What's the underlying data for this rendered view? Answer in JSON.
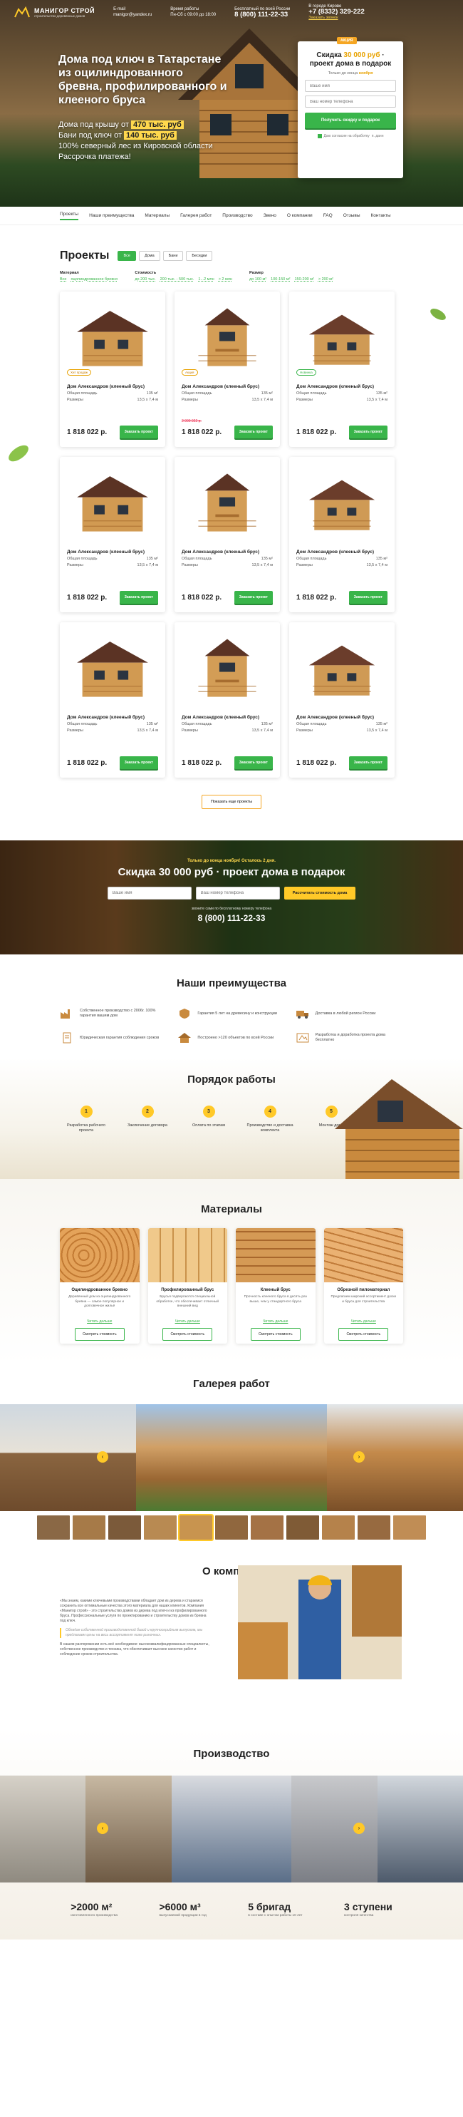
{
  "header": {
    "logo_name": "МАНИГОР СТРОЙ",
    "logo_sub": "строительство деревянных домов",
    "email_label": "E-mail",
    "email": "manigor@yandex.ru",
    "hours_label": "Время работы",
    "hours": "Пн-Сб с 09:00 до 18:00",
    "free_call_label": "Бесплатный по всей России",
    "free_phone": "8 (800) 111-22-33",
    "city_label": "В городе Кирове",
    "city_phone": "+7 (8332) 329-222",
    "callback_link": "Заказать звонок"
  },
  "hero": {
    "title": "Дома под ключ в Татарстане из оцилиндрованного бревна, профилированного и клееного бруса",
    "line1_prefix": "Дома под крышу от",
    "line1_price": "470 тыс. руб",
    "line2_prefix": "Бани под ключ от",
    "line2_price": "140 тыс. руб",
    "line3": "100% северный лес из Кировской области",
    "line4": "Рассрочка платежа!"
  },
  "hero_form": {
    "badge": "АКЦИЯ",
    "title_pre": "Скидка",
    "title_acc": "30 000 руб",
    "title_post": "· проект дома в подарок",
    "note_pre": "Только до конца",
    "note_acc": "ноября",
    "name_placeholder": "Ваше имя",
    "phone_placeholder": "Ваш номер телефона",
    "submit": "Получить скидку и подарок",
    "agree": "Даю согласие на обработку",
    "agree_suffix": "п. данн"
  },
  "nav": [
    "Проекты",
    "Наши преимущества",
    "Материалы",
    "Галерея работ",
    "Производство",
    "Звено",
    "О компании",
    "FAQ",
    "Отзывы",
    "Контакты"
  ],
  "projects": {
    "title": "Проекты",
    "tabs": [
      "Все",
      "Дома",
      "Бани",
      "Беседки"
    ],
    "filter_material_label": "Материал",
    "filter_materials": [
      "Все",
      "оцилиндрованное бревно"
    ],
    "filter_cost_label": "Стоимость",
    "filter_costs": [
      "до 200 тыс.",
      "200 тыс. - 500 тыс.",
      "1...2 млн",
      "> 2 млн"
    ],
    "filter_size_label": "Размер",
    "filter_sizes": [
      "до 100 м²",
      "100-150 м²",
      "150-200 м²",
      "> 200 м²"
    ],
    "cards": [
      {
        "name": "Дом Александров (клееный брус)",
        "area_label": "Общая площадь",
        "area": "135 м²",
        "size_label": "Размеры",
        "size": "13,5 х 7,4 м",
        "price": "1 818 022 р.",
        "button": "Заказать проект",
        "badge": "Хит продаж",
        "old_price": ""
      },
      {
        "name": "Дом Александров (клееный брус)",
        "area_label": "Общая площадь",
        "area": "135 м²",
        "size_label": "Размеры",
        "size": "13,5 х 7,4 м",
        "price": "1 818 022 р.",
        "button": "Заказать проект",
        "badge": "Акция",
        "old_price": "2 000 022 р."
      },
      {
        "name": "Дом Александров (клееный брус)",
        "area_label": "Общая площадь",
        "area": "135 м²",
        "size_label": "Размеры",
        "size": "13,5 х 7,4 м",
        "price": "1 818 022 р.",
        "button": "Заказать проект",
        "badge": "Новинка",
        "old_price": ""
      },
      {
        "name": "Дом Александров (клееный брус)",
        "area_label": "Общая площадь",
        "area": "135 м²",
        "size_label": "Размеры",
        "size": "13,5 х 7,4 м",
        "price": "1 818 022 р.",
        "button": "Заказать проект",
        "badge": "",
        "old_price": ""
      },
      {
        "name": "Дом Александров (клееный брус)",
        "area_label": "Общая площадь",
        "area": "135 м²",
        "size_label": "Размеры",
        "size": "13,5 х 7,4 м",
        "price": "1 818 022 р.",
        "button": "Заказать проект",
        "badge": "",
        "old_price": ""
      },
      {
        "name": "Дом Александров (клееный брус)",
        "area_label": "Общая площадь",
        "area": "135 м²",
        "size_label": "Размеры",
        "size": "13,5 х 7,4 м",
        "price": "1 818 022 р.",
        "button": "Заказать проект",
        "badge": "",
        "old_price": ""
      },
      {
        "name": "Дом Александров (клееный брус)",
        "area_label": "Общая площадь",
        "area": "135 м²",
        "size_label": "Размеры",
        "size": "13,5 х 7,4 м",
        "price": "1 818 022 р.",
        "button": "Заказать проект",
        "badge": "",
        "old_price": ""
      },
      {
        "name": "Дом Александров (клееный брус)",
        "area_label": "Общая площадь",
        "area": "135 м²",
        "size_label": "Размеры",
        "size": "13,5 х 7,4 м",
        "price": "1 818 022 р.",
        "button": "Заказать проект",
        "badge": "",
        "old_price": ""
      },
      {
        "name": "Дом Александров (клееный брус)",
        "area_label": "Общая площадь",
        "area": "135 м²",
        "size_label": "Размеры",
        "size": "13,5 х 7,4 м",
        "price": "1 818 022 р.",
        "button": "Заказать проект",
        "badge": "",
        "old_price": ""
      }
    ],
    "show_all": "Показать еще проекты"
  },
  "promo": {
    "kicker": "Только до конца ноября! Осталось 2 дня.",
    "title": "Скидка 30 000 руб · проект дома в подарок",
    "name_placeholder": "Ваше имя",
    "phone_placeholder": "Ваш номер телефона",
    "submit": "Рассчитать стоимость дома",
    "sub": "звоните сами по бесплатному номеру телефона",
    "phone": "8 (800) 111-22-33"
  },
  "advantages": {
    "title": "Наши преимущества",
    "items": [
      "Собственное производство с 2006г. 100% гарантия вашим дом",
      "Гарантия 5 лет на древесину и конструкции",
      "Доставка в любой регион России",
      "Юридическая гарантия соблюдения сроков",
      "Построено >120 объектов по всей России",
      "Разработка и доработка проекта дома бесплатно"
    ]
  },
  "steps": {
    "title": "Порядок работы",
    "items": [
      {
        "num": "1",
        "label": "Разработка рабочего проекта"
      },
      {
        "num": "2",
        "label": "Заключение договора"
      },
      {
        "num": "3",
        "label": "Оплата по этапам"
      },
      {
        "num": "4",
        "label": "Производство и доставка комплекта"
      },
      {
        "num": "5",
        "label": "Монтаж дома"
      }
    ]
  },
  "materials": {
    "title": "Материалы",
    "items": [
      {
        "name": "Оцилиндрованное бревно",
        "desc": "Деревянный дом из оцилиндрованного бревна — самое популярное и долговечное жильё",
        "more": "Читать дальше",
        "button": "Смотреть стоимость"
      },
      {
        "name": "Профилированный брус",
        "desc": "Брусья подвергаются специальной обработке, что обеспечивает отличный внешний вид",
        "more": "Читать дальше",
        "button": "Смотреть стоимость"
      },
      {
        "name": "Клееный брус",
        "desc": "Прочность клееного бруса в десять раз выше, чем у стандартного бруса",
        "more": "Читать дальше",
        "button": "Смотреть стоимость"
      },
      {
        "name": "Обрезной пиломатериал",
        "desc": "Предлагаем широкий ассортимент доски и бруса для строительства",
        "more": "Читать дальше",
        "button": "Смотреть стоимость"
      }
    ]
  },
  "gallery": {
    "title": "Галерея работ",
    "prev": "‹",
    "next": "›"
  },
  "about": {
    "title": "О компании",
    "p1": "«Мы знаем, какими ключевыми производствами обладает дом из дерева и стараемся сохранить все оптимальные качества этого материала для наших клиентов. Компания «Манигор строй» - это строительство домов из дерева под ключ и из профилированного бруса. Профессиональные услуги по проектированию и строительству домов из бревна под ключ.",
    "quote": "Обладая собственной производственной базой и крупносерийным выпуском, мы предлагаем цены на весь ассортимент ниже рыночных.",
    "p2": "В нашем распоряжении есть всё необходимое: высококвалифицированные специалисты, собственное производство и техника, что обеспечивает высокое качество работ и соблюдение сроков строительства."
  },
  "production": {
    "title": "Производство",
    "stats": [
      {
        "num": ">2000 м²",
        "label": "изготовленного производства"
      },
      {
        "num": ">6000 м³",
        "label": "выпускаемой продукции в год"
      },
      {
        "num": "5 бригад",
        "label": "в составе с опытом работы 10 лет"
      },
      {
        "num": "3 ступени",
        "label": "контроля качества"
      }
    ]
  },
  "colors": {
    "accent_green": "#39b54a",
    "accent_yellow": "#ffc928",
    "wood": "#c98a3e",
    "roof": "#6b3d2b"
  }
}
